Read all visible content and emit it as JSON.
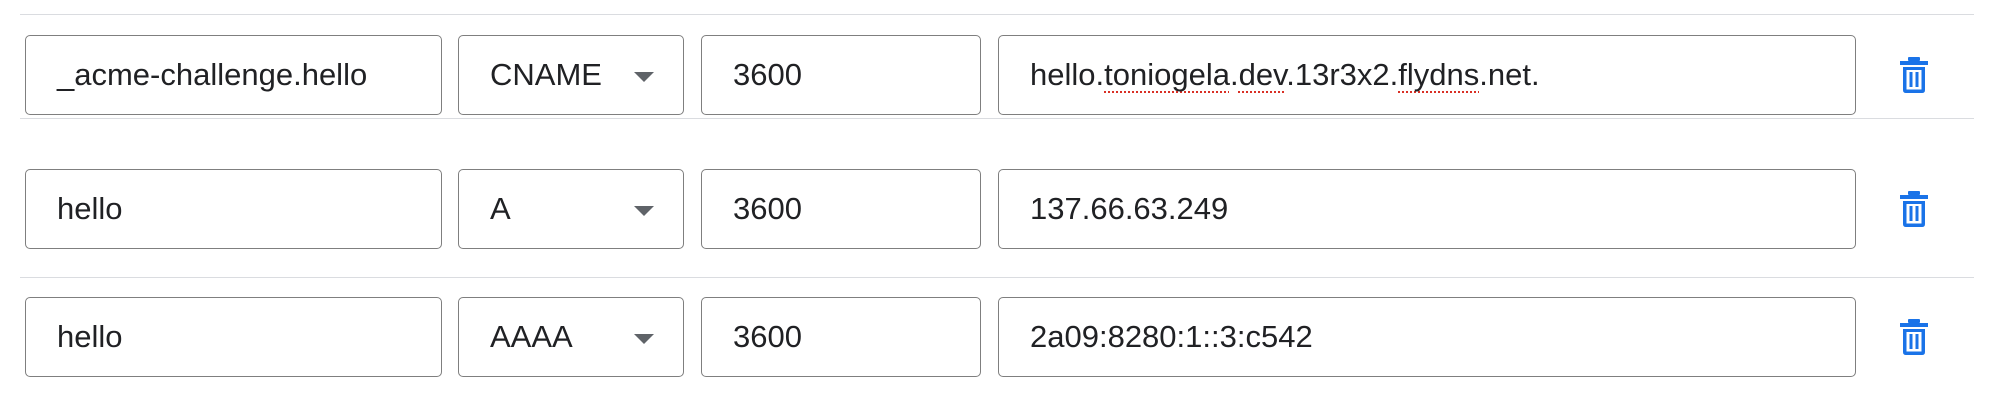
{
  "records": [
    {
      "host": "_acme-challenge.hello",
      "type": "CNAME",
      "ttl": "3600",
      "data_parts": [
        {
          "text": "hello.",
          "flagged": false
        },
        {
          "text": "toniogela",
          "flagged": true
        },
        {
          "text": ".",
          "flagged": false
        },
        {
          "text": "dev",
          "flagged": true
        },
        {
          "text": ".13r3x2.",
          "flagged": false
        },
        {
          "text": "flydns",
          "flagged": true
        },
        {
          "text": ".net.",
          "flagged": false
        }
      ],
      "delete_icon": "trash-icon"
    },
    {
      "host": "hello",
      "type": "A",
      "ttl": "3600",
      "data": "137.66.63.249",
      "delete_icon": "trash-icon"
    },
    {
      "host": "hello",
      "type": "AAAA",
      "ttl": "3600",
      "data": "2a09:8280:1::3:c542",
      "delete_icon": "trash-icon"
    }
  ],
  "colors": {
    "accent": "#1a73e8",
    "border": "#7f7f7f",
    "divider": "#dadce0",
    "spellcheck": "#d93025",
    "text": "#202124"
  }
}
